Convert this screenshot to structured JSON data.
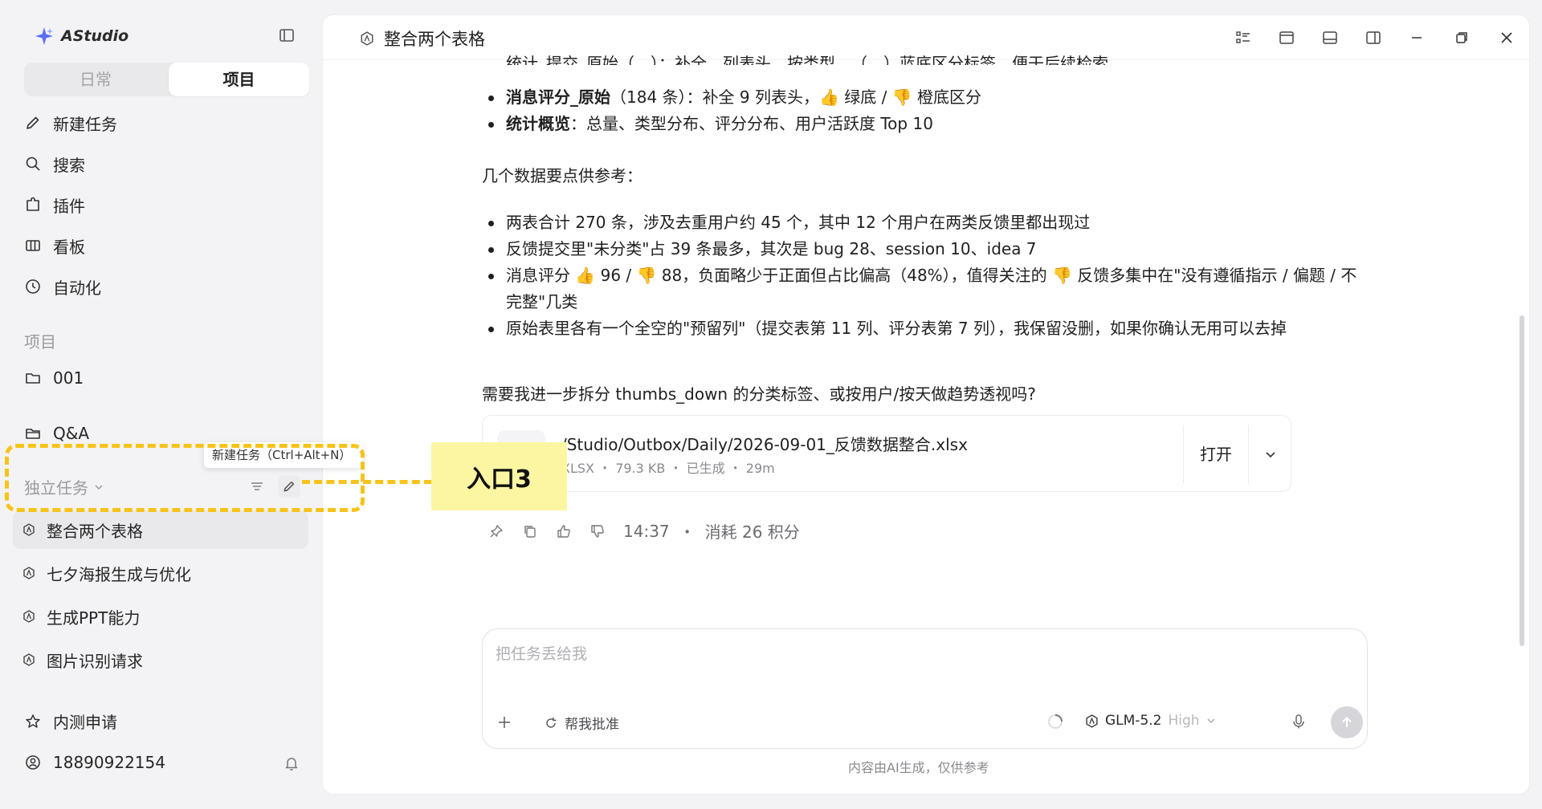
{
  "sidebar": {
    "app_name": "AStudio",
    "tabs": [
      {
        "label": "日常"
      },
      {
        "label": "项目"
      }
    ],
    "nav": [
      {
        "label": "新建任务",
        "icon": "pencil-icon"
      },
      {
        "label": "搜索",
        "icon": "search-icon"
      },
      {
        "label": "插件",
        "icon": "plugin-icon"
      },
      {
        "label": "看板",
        "icon": "board-icon"
      },
      {
        "label": "自动化",
        "icon": "clock-icon"
      }
    ],
    "projects_label": "项目",
    "projects": [
      {
        "label": "001",
        "icon": "folder-icon"
      },
      {
        "label": "Q&A",
        "icon": "folder-icon"
      }
    ],
    "independent_label": "独立任务",
    "tooltip": "新建任务（Ctrl+Alt+N）",
    "tasks": [
      {
        "label": "整合两个表格",
        "active": true
      },
      {
        "label": "七夕海报生成与优化"
      },
      {
        "label": "生成PPT能力"
      },
      {
        "label": "图片识别请求"
      }
    ],
    "beta": "内测申请",
    "user": "18890922154"
  },
  "annotation": {
    "callout": "入口3",
    "color": "#f7c31b"
  },
  "main": {
    "title": "整合两个表格",
    "cut_line": "统计_提交_原始（…）：补全…列表头，按类型…（…）蓝底区分标签，便于后续检索",
    "bullets_top": [
      {
        "bold": "消息评分_原始",
        "text": "（184 条）：补全 9 列表头，👍 绿底 / 👎 橙底区分"
      },
      {
        "bold": "统计概览",
        "text": "：总量、类型分布、评分分布、用户活跃度 Top 10"
      }
    ],
    "points_heading": "几个数据要点供参考：",
    "bullets_points": [
      "两表合计 270 条，涉及去重用户约 45 个，其中 12 个用户在两类反馈里都出现过",
      "反馈提交里\"未分类\"占 39 条最多，其次是 bug 28、session 10、idea 7",
      "消息评分 👍 96 / 👎 88，负面略少于正面但占比偏高（48%），值得关注的 👎 反馈多集中在\"没有遵循指示 / 偏题 / 不完整\"几类",
      "原始表里各有一个全空的\"预留列\"（提交表第 11 列、评分表第 7 列），我保留没删，如果你确认无用可以去掉"
    ],
    "followup": "需要我进一步拆分 thumbs_down 的分类标签、或按用户/按天做趋势透视吗?",
    "file": {
      "name": "/Studio/Outbox/Daily/2026-09-01_反馈数据整合.xlsx",
      "type": "XLSX",
      "size": "79.3 KB",
      "status": "已生成",
      "age": "29m",
      "open_label": "打开"
    },
    "meta": {
      "time": "14:37",
      "cost": "消耗 26 积分"
    },
    "composer": {
      "placeholder": "把任务丢给我",
      "approve_label": "帮我批准",
      "model": "GLM-5.2",
      "level": "High"
    },
    "disclaimer": "内容由AI生成，仅供参考"
  }
}
